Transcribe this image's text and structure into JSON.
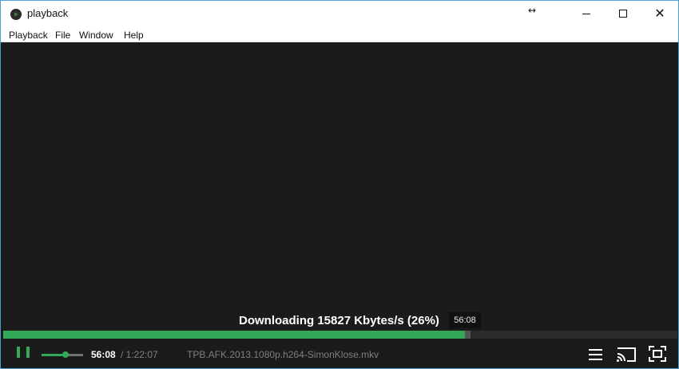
{
  "window": {
    "title": "playback"
  },
  "menubar": {
    "items": [
      "Playback",
      "File",
      "Window",
      "Help"
    ]
  },
  "overlay": {
    "status": "Downloading 15827 Kbytes/s (26%)",
    "hover_time": "56:08"
  },
  "progress": {
    "played": 0.685,
    "buffered": 0.693
  },
  "volume": {
    "level": 0.58
  },
  "controls": {
    "current_time": "56:08",
    "total_time": "/ 1:22:07",
    "filename": "TPB.AFK.2013.1080p.h264-SimonKlose.mkv"
  },
  "colors": {
    "accent": "#31a957",
    "background": "#1b1b1c",
    "titlebar": "#ffffff",
    "window_border": "#4a9fd4"
  },
  "icons": [
    "app-icon",
    "resize-cursor-icon",
    "minimize-icon",
    "maximize-icon",
    "close-icon",
    "pause-icon",
    "menu-icon",
    "cast-icon",
    "fullscreen-icon"
  ]
}
